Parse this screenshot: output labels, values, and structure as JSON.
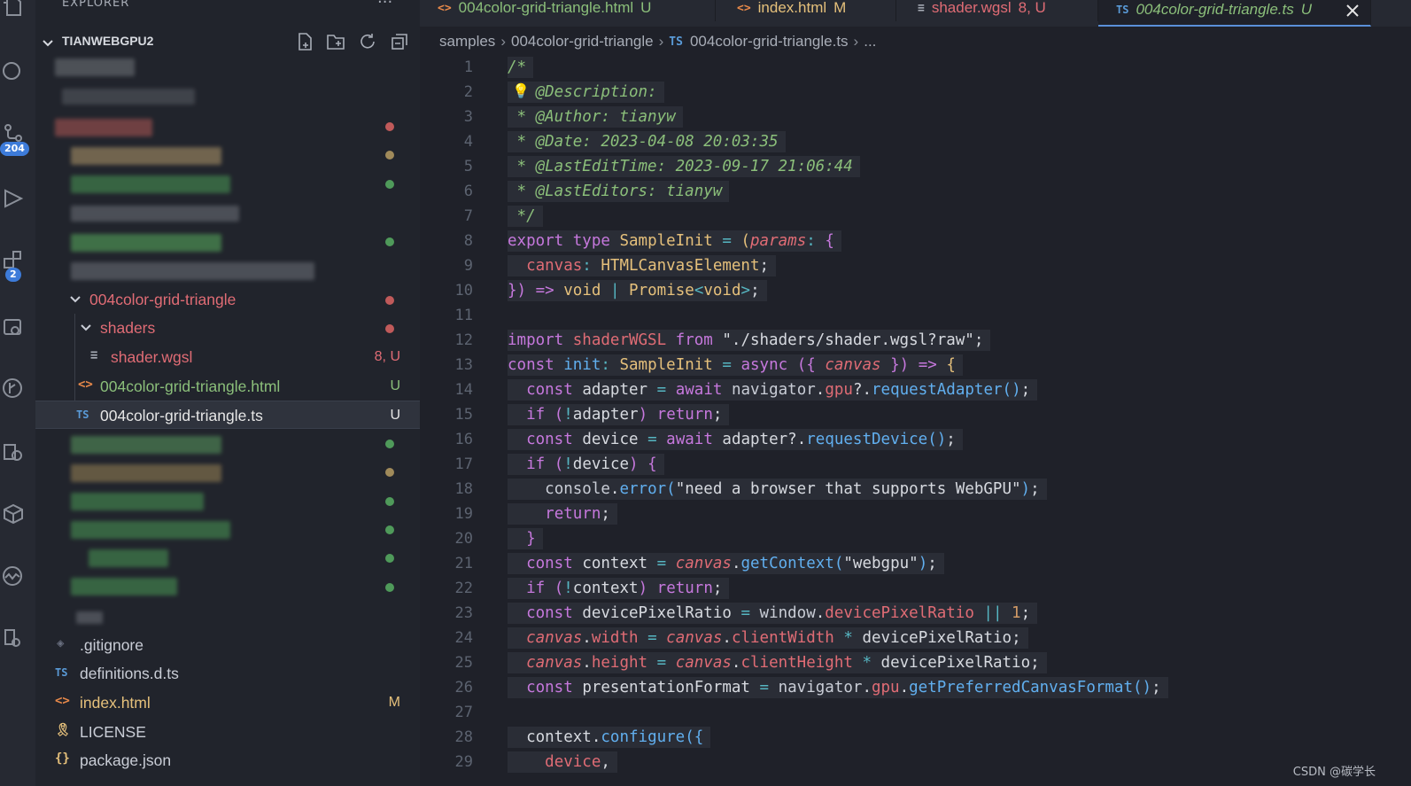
{
  "explorer": {
    "title": "EXPLORER",
    "more": "···",
    "workspace": "TIANWEBGPU2",
    "badges": {
      "source_control": "204",
      "extensions": "2"
    }
  },
  "tree": {
    "folder": "004color-grid-triangle",
    "subfolder": "shaders",
    "file_wgsl": {
      "name": "shader.wgsl",
      "status": "8, U"
    },
    "file_html": {
      "name": "004color-grid-triangle.html",
      "status": "U"
    },
    "file_ts": {
      "name": "004color-grid-triangle.ts",
      "status": "U",
      "icon": "TS"
    },
    "root_files": [
      {
        "name": ".gitignore",
        "icon": "◈",
        "status": ""
      },
      {
        "name": "definitions.d.ts",
        "icon": "TS",
        "status": ""
      },
      {
        "name": "index.html",
        "icon": "<>",
        "status": "M"
      },
      {
        "name": "LICENSE",
        "icon": "🎗",
        "status": ""
      },
      {
        "name": "package.json",
        "icon": "{}",
        "status": ""
      }
    ]
  },
  "tabs": [
    {
      "icon": "<>",
      "label": "004color-grid-triangle.html",
      "status": "U"
    },
    {
      "icon": "<>",
      "label": "index.html",
      "status": "M"
    },
    {
      "icon": "≡",
      "label": "shader.wgsl",
      "status": "8, U"
    },
    {
      "icon": "TS",
      "label": "004color-grid-triangle.ts",
      "status": "U"
    }
  ],
  "breadcrumb": {
    "parts": [
      "samples",
      "004color-grid-triangle",
      "004color-grid-triangle.ts",
      "..."
    ],
    "ts_icon": "TS"
  },
  "code": {
    "line_numbers": [
      "1",
      "2",
      "3",
      "4",
      "5",
      "6",
      "7",
      "8",
      "9",
      "10",
      "11",
      "12",
      "13",
      "14",
      "15",
      "16",
      "17",
      "18",
      "19",
      "20",
      "21",
      "22",
      "23",
      "24",
      "25",
      "26",
      "27",
      "28",
      "29"
    ]
  },
  "watermark": "CSDN @碳学长",
  "colors": {
    "accent": "#5a8fd8",
    "untracked": "#8bbf7a",
    "modified": "#e5c07b",
    "error": "#e06c75"
  }
}
